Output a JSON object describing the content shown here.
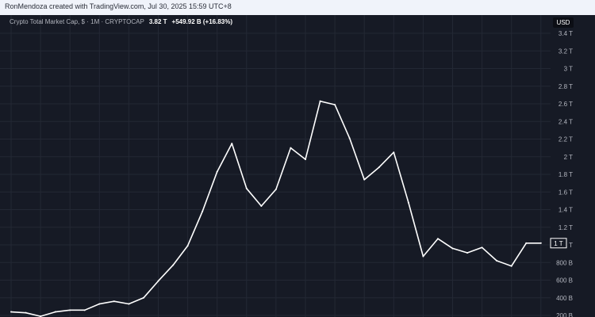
{
  "header": {
    "credit": "RonMendoza created with TradingView.com, Jul 30, 2025 15:59 UTC+8"
  },
  "legend": {
    "title": "Crypto Total Market Cap, $ · 1M · CRYPTOCAP",
    "last_value": "3.82 T",
    "change": "+549.92 B (+16.83%)"
  },
  "currency": "USD",
  "colors": {
    "background": "#161a25",
    "grid": "#232834",
    "line": "#ffffff",
    "axis_text": "#b2b5be"
  },
  "chart_data": {
    "type": "line",
    "title": "Crypto Total Market Cap, $ · 1M · CRYPTOCAP",
    "series": [
      {
        "values": [
          240,
          230,
          190,
          240,
          260,
          260,
          330,
          360,
          330,
          400,
          590,
          770,
          990,
          1380,
          1830,
          2150,
          1640,
          1440,
          1630,
          2100,
          1970,
          2630,
          2590,
          2210,
          1740,
          1880,
          2050,
          1480,
          870,
          1070,
          960,
          910,
          970,
          820,
          760,
          1020,
          1020
        ]
      }
    ],
    "ylim": [
      200,
      3400
    ],
    "y_ticks": [
      {
        "value": 200,
        "label": "200 B"
      },
      {
        "value": 400,
        "label": "400 B"
      },
      {
        "value": 600,
        "label": "600 B"
      },
      {
        "value": 800,
        "label": "800 B"
      },
      {
        "value": 1000,
        "label": "1 T"
      },
      {
        "value": 1200,
        "label": "1.2 T"
      },
      {
        "value": 1400,
        "label": "1.4 T"
      },
      {
        "value": 1600,
        "label": "1.6 T"
      },
      {
        "value": 1800,
        "label": "1.8 T"
      },
      {
        "value": 2000,
        "label": "2 T"
      },
      {
        "value": 2200,
        "label": "2.2 T"
      },
      {
        "value": 2400,
        "label": "2.4 T"
      },
      {
        "value": 2600,
        "label": "2.6 T"
      },
      {
        "value": 2800,
        "label": "2.8 T"
      },
      {
        "value": 3000,
        "label": "3 T"
      },
      {
        "value": 3200,
        "label": "3.2 T"
      },
      {
        "value": 3400,
        "label": "3.4 T"
      }
    ],
    "last_price_label": "1 T",
    "grid": true,
    "legend": "top-left"
  }
}
